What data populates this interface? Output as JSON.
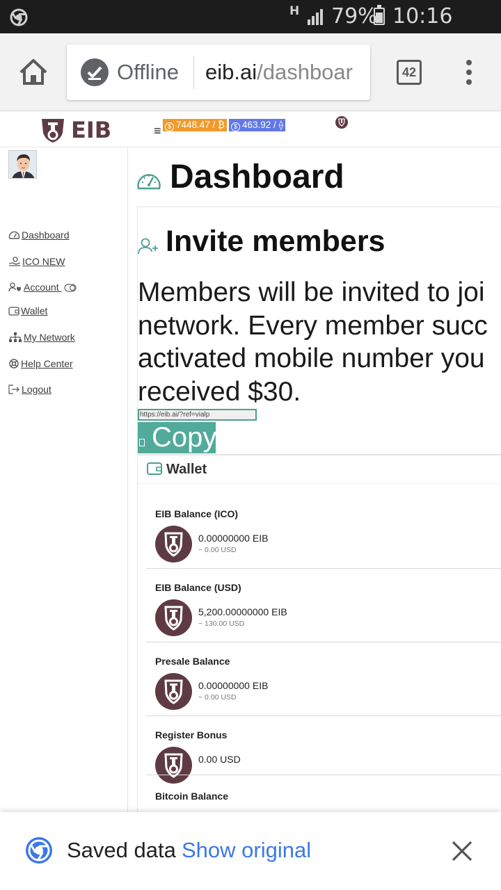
{
  "status_bar": {
    "network_badge": "H",
    "battery": "79%",
    "time": "10:16 a.m."
  },
  "browser": {
    "security_label": "Offline",
    "url_host": "eib.ai",
    "url_path": "/dashboar",
    "tab_count": "42"
  },
  "header": {
    "logo_text": "EIB",
    "menu_glyph": "≡",
    "btc_ticker": "7448.47 / ₿",
    "eth_ticker": "463.92 / ⟠"
  },
  "sidebar": {
    "items": [
      {
        "label": "Dashboard",
        "icon": "gauge-icon"
      },
      {
        "label": "ICO NEW",
        "icon": "hand-coin-icon"
      },
      {
        "label": "Account",
        "icon": "user-shield-icon"
      },
      {
        "label": "Wallet",
        "icon": "wallet-icon"
      },
      {
        "label": "My Network",
        "icon": "sitemap-icon"
      },
      {
        "label": "Help Center",
        "icon": "lifebuoy-icon"
      },
      {
        "label": "Logout",
        "icon": "sign-out-icon"
      }
    ]
  },
  "main": {
    "title": "Dashboard",
    "invite": {
      "title": "Invite members",
      "text_lines": [
        "Members will be invited to joi",
        "network. Every member succ",
        "activated mobile number you",
        "received $30."
      ],
      "ref_link": "https://eib.ai/?ref=vialp",
      "copy_label": "Copy"
    },
    "wallet": {
      "title": "Wallet",
      "balances": [
        {
          "label": "EIB Balance (ICO)",
          "amount": "0.00000000 EIB",
          "usd": "~ 0.00 USD"
        },
        {
          "label": "EIB Balance (USD)",
          "amount": "5,200.00000000 EIB",
          "usd": "~ 130.00 USD"
        },
        {
          "label": "Presale Balance",
          "amount": "0.00000000 EIB",
          "usd": "~ 0.00 USD"
        },
        {
          "label": "Register Bonus",
          "amount": "0.00 USD",
          "usd": ""
        },
        {
          "label": "Bitcoin Balance",
          "amount": "",
          "usd": ""
        }
      ]
    }
  },
  "bottom_bar": {
    "saved_text": "Saved data",
    "show_original": "Show original"
  },
  "colors": {
    "brand": "#5e3b42",
    "accent": "#51aa9a",
    "btc": "#f09b2c",
    "eth": "#6278e6",
    "link_blue": "#3b78e7"
  }
}
